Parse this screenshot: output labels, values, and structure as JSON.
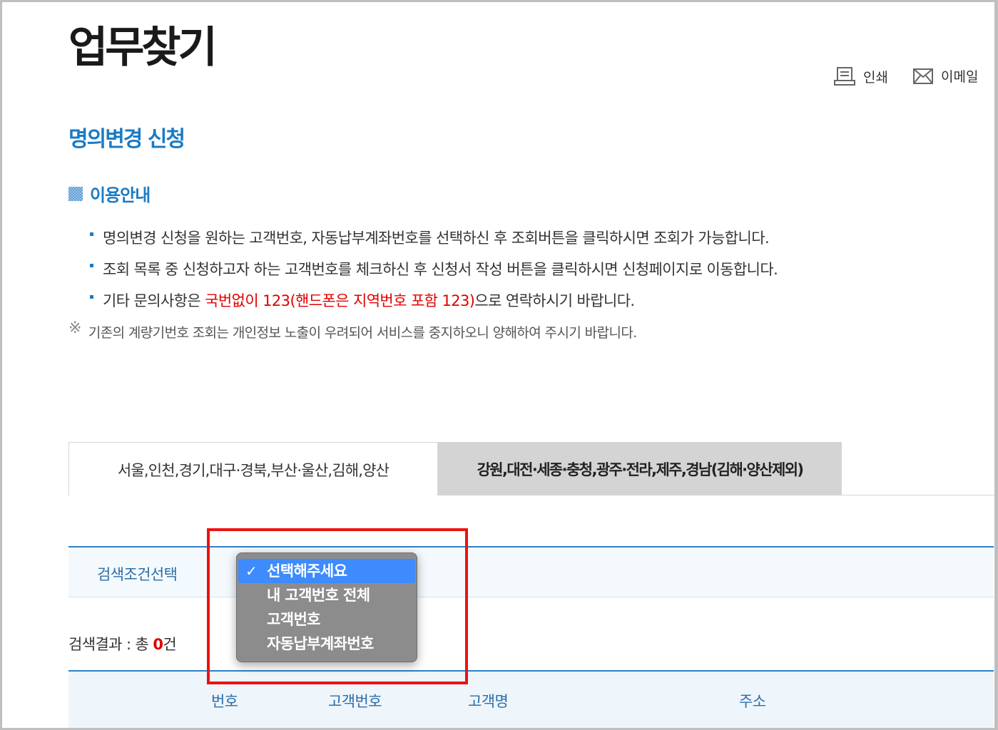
{
  "page": {
    "title": "업무찾기"
  },
  "utility": {
    "print_label": "인쇄",
    "email_label": "이메일"
  },
  "section": {
    "title": "명의변경 신청"
  },
  "guide": {
    "title": "이용안내",
    "items": [
      "명의변경 신청을 원하는 고객번호, 자동납부계좌번호를 선택하신 후 조회버튼을 클릭하시면 조회가 가능합니다.",
      "조회 목록 중 신청하고자 하는 고객번호를 체크하신 후 신청서 작성 버튼을 클릭하시면 신청페이지로 이동합니다."
    ],
    "item3": {
      "before": "기타 문의사항은 ",
      "highlight": "국번없이 123(핸드폰은 지역번호 포함 123)",
      "after": "으로 연락하시기 바랍니다."
    },
    "note_mark": "※",
    "note": "기존의 계량기번호 조회는 개인정보 노출이 우려되어 서비스를 중지하오니 양해하여 주시기 바랍니다."
  },
  "tabs": [
    {
      "label": "서울,인천,경기,대구·경북,부산·울산,김해,양산",
      "active": false
    },
    {
      "label": "강원,대전·세종·충청,광주·전라,제주,경남(김해·양산제외)",
      "active": true
    }
  ],
  "search": {
    "label": "검색조건선택",
    "options": [
      "선택해주세요",
      "내 고객번호 전체",
      "고객번호",
      "자동납부계좌번호"
    ],
    "selected": "선택해주세요",
    "check_mark": "✓"
  },
  "result": {
    "prefix": "검색결과 : 총 ",
    "count": "0",
    "suffix": "건"
  },
  "table": {
    "headers": [
      "번호",
      "고객번호",
      "고객명",
      "주소"
    ]
  },
  "colors": {
    "accent": "#1a7bc4",
    "highlight_red": "#ee1111",
    "selected_option": "#3d8bfd"
  }
}
